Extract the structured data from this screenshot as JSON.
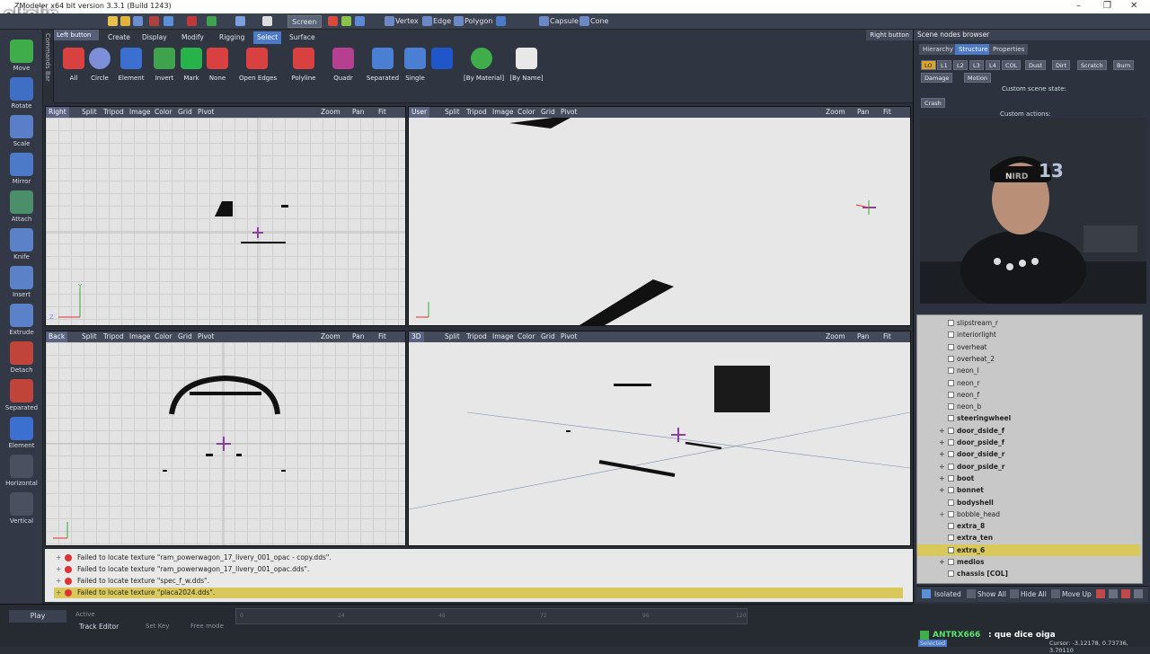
{
  "window": {
    "title": "ZModeler x64 bit version 3.3.1 (Build 1243)",
    "controls": [
      "–",
      "❐",
      "✕"
    ]
  },
  "overlay": {
    "logo": "eltolin"
  },
  "toolbar": {
    "screen_label": "Screen",
    "items": [
      "Vertex",
      "Edge",
      "Polygon",
      "Capsule",
      "Cone"
    ]
  },
  "left_tools": [
    "Move",
    "Rotate",
    "Scale",
    "Mirror",
    "Attach",
    "Knife",
    "Insert",
    "Extrude",
    "Detach",
    "Separated",
    "Element",
    "Horizontal",
    "Vertical"
  ],
  "command_strip_label": "Commands Bar",
  "left_button_label": "Left button",
  "right_button_label": "Right button",
  "ribbon": {
    "tabs": [
      "Create",
      "Display",
      "Modify",
      "Rigging",
      "Select",
      "Surface"
    ],
    "active_tab": "Select",
    "buttons": [
      "All",
      "Circle",
      "Element",
      "Invert",
      "Mark",
      "None",
      "Open Edges",
      "Polyline",
      "Quadr",
      "Separated",
      "Single",
      "[By Material]",
      "[By Name]"
    ]
  },
  "viewports": {
    "tools": [
      "Split",
      "Tripod",
      "Image",
      "Color",
      "Grid",
      "Pivot"
    ],
    "zoom": "Zoom",
    "pan": "Pan",
    "fit": "Fit",
    "right": {
      "name": "Right"
    },
    "user": {
      "name": "User"
    },
    "back": {
      "name": "Back"
    },
    "persp": {
      "name": "3D"
    },
    "axis": {
      "x": "X",
      "y": "Y",
      "z": "Z"
    }
  },
  "messages": {
    "strip_label": "Messages",
    "items": [
      {
        "text": "Failed to locate texture \"ram_powerwagon_17_livery_001_opac - copy.dds\"."
      },
      {
        "text": "Failed to locate texture \"ram_powerwagon_17_livery_001_opac.dds\"."
      },
      {
        "text": "Failed to locate texture \"spec_f_w.dds\"."
      },
      {
        "text": "Failed to locate texture \"placa2024.dds\"."
      }
    ]
  },
  "timeline": {
    "play": "Play",
    "active": "Active",
    "track_editor": "Track Editor",
    "set_key": "Set Key",
    "free_mode": "Free mode",
    "ticks": [
      "0",
      "24",
      "48",
      "72",
      "96",
      "120"
    ]
  },
  "scene": {
    "title": "Scene nodes browser",
    "tabs": [
      "Hierarchy",
      "Structure",
      "Properties"
    ],
    "active_tab": "Structure",
    "state_chips": [
      "LO",
      "L1",
      "L2",
      "L3",
      "L4",
      "COL",
      "Dust",
      "Dirt",
      "Scratch",
      "Burn"
    ],
    "damage": "Damage",
    "motion": "Motion",
    "custom_state": "Custom scene state:",
    "crash": "Crash",
    "custom_actions": "Custom actions:",
    "webcam_number": "13",
    "nodes": [
      {
        "name": "slipstream_r",
        "bold": false,
        "exp": false
      },
      {
        "name": "interiorlight",
        "bold": false,
        "exp": false
      },
      {
        "name": "overheat",
        "bold": false,
        "exp": false
      },
      {
        "name": "overheat_2",
        "bold": false,
        "exp": false
      },
      {
        "name": "neon_l",
        "bold": false,
        "exp": false
      },
      {
        "name": "neon_r",
        "bold": false,
        "exp": false
      },
      {
        "name": "neon_f",
        "bold": false,
        "exp": false
      },
      {
        "name": "neon_b",
        "bold": false,
        "exp": false
      },
      {
        "name": "steeringwheel",
        "bold": true,
        "exp": false
      },
      {
        "name": "door_dside_f",
        "bold": true,
        "exp": true
      },
      {
        "name": "door_pside_f",
        "bold": true,
        "exp": true
      },
      {
        "name": "door_dside_r",
        "bold": true,
        "exp": true
      },
      {
        "name": "door_pside_r",
        "bold": true,
        "exp": true
      },
      {
        "name": "boot",
        "bold": true,
        "exp": true
      },
      {
        "name": "bonnet",
        "bold": true,
        "exp": true
      },
      {
        "name": "bodyshell",
        "bold": true,
        "exp": false
      },
      {
        "name": "bobble_head",
        "bold": false,
        "exp": true
      },
      {
        "name": "extra_8",
        "bold": true,
        "exp": false
      },
      {
        "name": "extra_ten",
        "bold": true,
        "exp": false
      },
      {
        "name": "extra_6",
        "bold": true,
        "exp": false,
        "sel": true
      },
      {
        "name": "medios",
        "bold": true,
        "exp": true
      },
      {
        "name": "chassis [COL]",
        "bold": true,
        "exp": false
      }
    ],
    "bottom_bar": [
      "Isolated",
      "Show All",
      "Hide All",
      "Move Up"
    ]
  },
  "status": {
    "chat_user": "ANTRX666",
    "chat_text": ": que dice oiga",
    "selected": "Selected",
    "cursor": "Cursor: -3.12178, 0.73736, 3.70110"
  },
  "colors": {
    "accent": "#4d79c9",
    "selection": "#d8c95a",
    "error": "#dd3333"
  }
}
